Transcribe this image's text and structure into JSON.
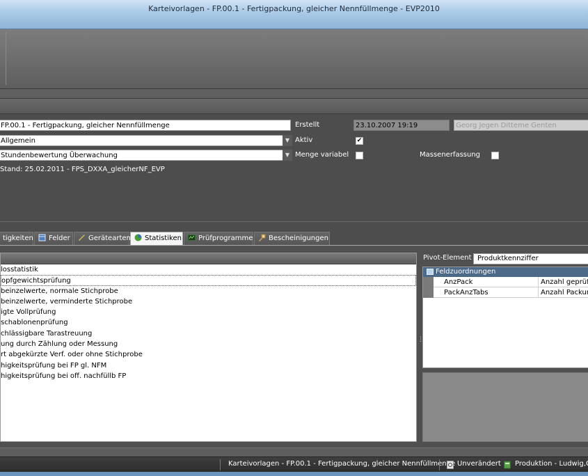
{
  "window": {
    "title": "Karteivorlagen - FP.00.1 - Fertigpackung, gleicher Nennfüllmenge - EVP2010"
  },
  "form": {
    "name": "FP.00.1 - Fertigpackung, gleicher Nennfüllmenge",
    "category": "Allgemein",
    "evaluation": "Stundenbewertung Überwachung",
    "created_label": "Erstellt",
    "created_date": "23.10.2007 19:19",
    "created_by": "Georg Jegen Ditteme Genten",
    "aktiv_label": "Aktiv",
    "aktiv_checked": true,
    "aktiv_mark": "✔",
    "menge_label": "Menge variabel",
    "masse_label": "Massenerfassung",
    "status_text": "Stand: 25.02.2011 - FPS_DXXA_gleicherNF_EVP"
  },
  "tabs": [
    {
      "label": "tigkeiten",
      "icon": "none"
    },
    {
      "label": "Felder",
      "icon": "grid-icon"
    },
    {
      "label": "Gerätearten",
      "icon": "pencil-icon"
    },
    {
      "label": "Statistiken",
      "icon": "chart-icon",
      "active": true
    },
    {
      "label": "Prüfprogramme",
      "icon": "program-icon"
    },
    {
      "label": "Bescheinigungen",
      "icon": "certificate-icon"
    }
  ],
  "statistics_list": [
    "losstatistik",
    "opfgewichtsprüfung",
    "beinzelwerte, normale Stichprobe",
    "beinzelwerte, verminderte Stichprobe",
    "igte Vollprüfung",
    "schablonenprüfung",
    "chlässigbare Tarastreuung",
    "ung durch Zählung oder Messung",
    "rt abgekürzte Verf. oder ohne Stichprobe",
    "higkeitsprüfung bei FP gl. NFM",
    "higkeitsprüfung bei off. nachfüllb FP"
  ],
  "pivot": {
    "label": "Pivot-Element",
    "value": "Produktkennziffer",
    "group_label": "Feldzuordnungen",
    "rows": [
      {
        "key": "AnzPack",
        "value": "Anzahl geprüft"
      },
      {
        "key": "PackAnzTabs",
        "value": "Anzahl Packun"
      }
    ]
  },
  "statusbar": {
    "doc": "Karteivorlagen - FP.00.1 - Fertigpackung, gleicher Nennfüllmenge",
    "state": "Unverändert",
    "user": "Produktion - Ludwig,Ge"
  }
}
